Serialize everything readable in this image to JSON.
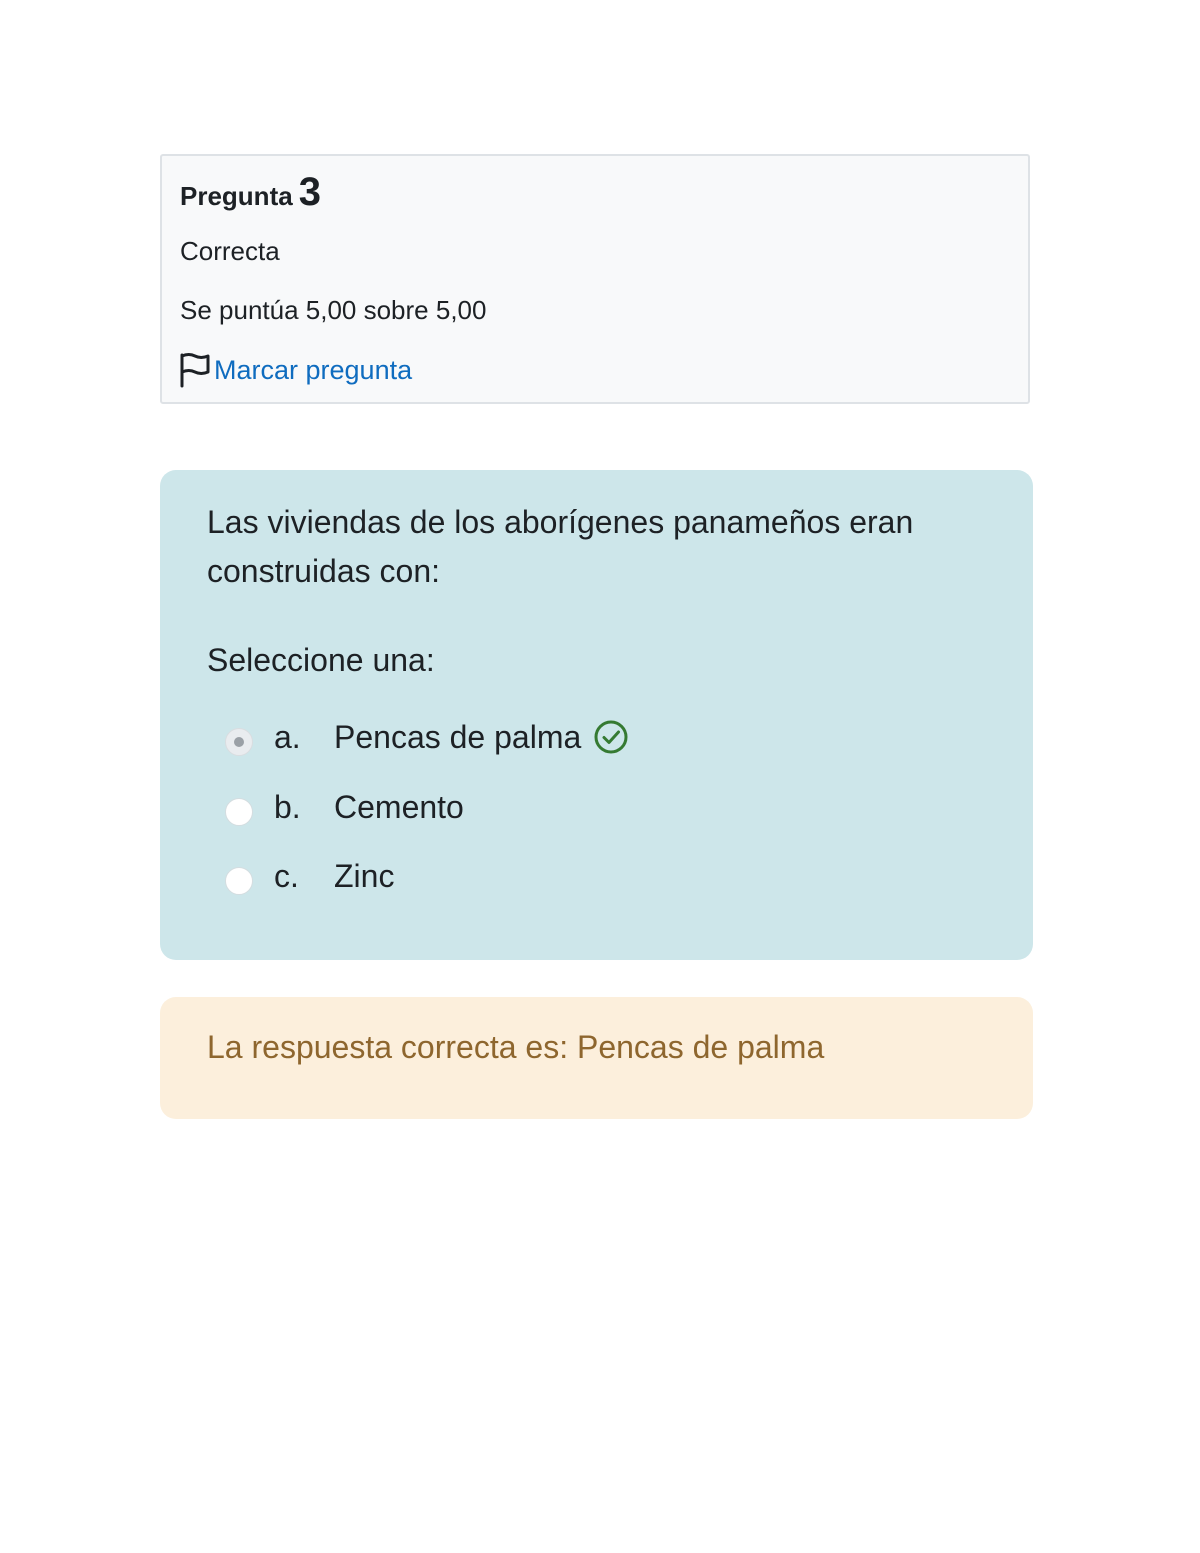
{
  "info": {
    "heading_label": "Pregunta",
    "question_number": "3",
    "state": "Correcta",
    "grade": "Se puntúa 5,00 sobre 5,00",
    "flag_label": "Marcar pregunta",
    "flag_icon": "flag-icon"
  },
  "question": {
    "text": "Las viviendas de los aborígenes panameños eran construidas con:",
    "prompt": "Seleccione una:",
    "answers": [
      {
        "letter": "a.",
        "text": "Pencas de palma",
        "checked": true,
        "correct": true
      },
      {
        "letter": "b.",
        "text": "Cemento",
        "checked": false,
        "correct": false
      },
      {
        "letter": "c.",
        "text": "Zinc",
        "checked": false,
        "correct": false
      }
    ],
    "correct_icon": "check-circle-icon"
  },
  "feedback": {
    "right_answer": "La respuesta correcta es: Pencas de palma"
  },
  "colors": {
    "info_bg": "#f8f9fa",
    "question_bg": "#cde6ea",
    "feedback_bg": "#fcefdc",
    "feedback_text": "#8e662e",
    "link": "#0f6cbf",
    "correct": "#357a32"
  }
}
